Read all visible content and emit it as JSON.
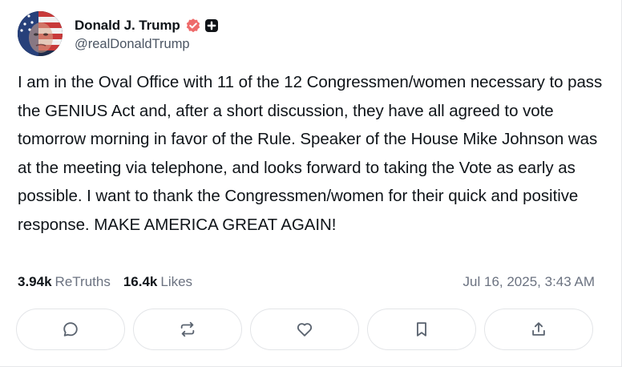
{
  "post": {
    "author": {
      "display_name": "Donald J. Trump",
      "handle": "@realDonaldTrump",
      "verified_color": "#ee6a6a"
    },
    "text": "I am in the Oval Office with 11 of the 12 Congressmen/women necessary to pass the GENIUS Act and, after a short discussion, they have all agreed to vote tomorrow morning in favor of the Rule. Speaker of the House Mike Johnson was at the meeting via telephone, and looks forward to taking the Vote as early as possible. I want to thank the Congressmen/women for their quick and positive response. MAKE AMERICA GREAT AGAIN!",
    "stats": {
      "retruths_count": "3.94k",
      "retruths_label": "ReTruths",
      "likes_count": "16.4k",
      "likes_label": "Likes"
    },
    "timestamp": "Jul 16, 2025, 3:43 AM"
  },
  "actions": [
    {
      "icon": "reply-icon"
    },
    {
      "icon": "retruth-icon"
    },
    {
      "icon": "like-icon"
    },
    {
      "icon": "bookmark-icon"
    },
    {
      "icon": "share-icon"
    }
  ]
}
